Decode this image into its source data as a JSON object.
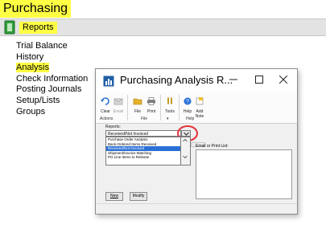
{
  "page": {
    "title": "Purchasing"
  },
  "reports_bar": {
    "label": "Reports"
  },
  "nav": {
    "items": [
      {
        "label": "Trial Balance",
        "highlighted": false
      },
      {
        "label": "History",
        "highlighted": false
      },
      {
        "label": "Analysis",
        "highlighted": true
      },
      {
        "label": "Check Information",
        "highlighted": false
      },
      {
        "label": "Posting Journals",
        "highlighted": false
      },
      {
        "label": "Setup/Lists",
        "highlighted": false
      },
      {
        "label": "Groups",
        "highlighted": false
      }
    ]
  },
  "dialog": {
    "title": "Purchasing Analysis R...",
    "ribbon": {
      "clear": "Clear",
      "email": "Email",
      "file": "File",
      "print": "Print",
      "tools": "Tools",
      "help": "Help",
      "add": "Add",
      "note": "Note",
      "group_actions": "Actions",
      "group_file": "File",
      "group_help": "Help"
    },
    "reports_label": "Reports:",
    "combo_value": "Received/Not Invoiced",
    "options": [
      {
        "label": "Purchase Order Analysis",
        "selected": false
      },
      {
        "label": "Back-Ordered Items Received",
        "selected": false
      },
      {
        "label": "Received/Not Invoiced",
        "selected": true
      },
      {
        "label": "Shipment/Invoice Matching",
        "selected": false
      },
      {
        "label": "PO Line Items to Release",
        "selected": false
      }
    ],
    "email_label": "Email or Print List:",
    "new_button": "New",
    "modify_button": "Modify"
  },
  "colors": {
    "highlight": "#ffff44",
    "selection": "#2a70d6",
    "callout": "#e2323a"
  }
}
